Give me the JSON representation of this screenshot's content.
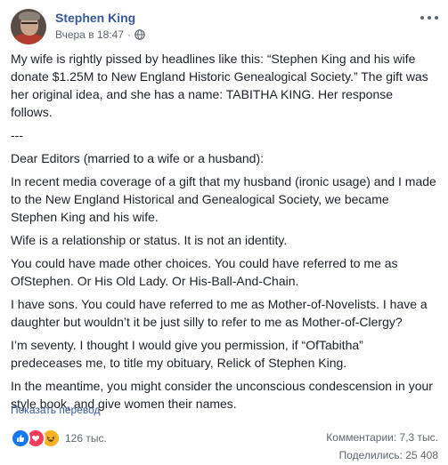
{
  "post": {
    "author": "Stephen King",
    "timestamp": "Вчера в 18:47",
    "separator": "·",
    "paragraphs": [
      "My wife is rightly pissed by headlines like this: “Stephen King and his wife donate $1.25M to New England Historic Genealogical Society.” The gift was her original idea, and she has a name: TABITHA KING. Her response follows.",
      "---",
      "Dear Editors (married to a wife or a husband):",
      "In recent media coverage of a gift that my husband (ironic usage) and I made to the New England Historical and Genealogical Society, we became Stephen King and his wife.",
      "Wife is a relationship or status. It is not an identity.",
      "You could have made other choices. You could have referred to me as OfStephen. Or His Old Lady. Or His-Ball-And-Chain.",
      "I have sons. You could have referred to me as Mother-of-Novelists. I have a daughter but wouldn’t it be just silly to refer to me as Mother-of-Clergy?",
      "I’m seventy. I thought I would give you permission, if “OfTabitha” predeceases me, to title my obituary, Relick of Stephen King.",
      "In the meantime, you might consider the unconscious condescension in your style book, and give women their names."
    ],
    "see_translation": "Показать перевод"
  },
  "footer": {
    "reaction_count": "126 тыс.",
    "comments": "Комментарии: 7,3 тыс.",
    "shares": "Поделились: 25 408"
  },
  "colors": {
    "link": "#385898",
    "text": "#1d2129",
    "secondary": "#616770",
    "like": "#1877f2",
    "love": "#f33e58",
    "haha": "#f7b125"
  },
  "icons": [
    "globe-icon",
    "more-options-icon",
    "like-reaction-icon",
    "love-reaction-icon",
    "haha-reaction-icon"
  ]
}
